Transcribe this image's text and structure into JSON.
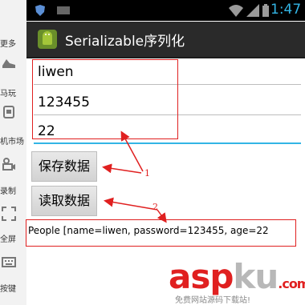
{
  "sidebar": {
    "items": [
      {
        "label": "更多",
        "icon": "more-icon"
      },
      {
        "label": "马玩",
        "icon": "shoe-icon"
      },
      {
        "label": "机市场",
        "icon": "market-icon"
      },
      {
        "label": "录制",
        "icon": "camera-icon"
      },
      {
        "label": "全屏",
        "icon": "fullscreen-icon"
      },
      {
        "label": "按键",
        "icon": "keyboard-icon"
      }
    ]
  },
  "statusbar": {
    "time": "1:47",
    "time_color": "#33b5e5"
  },
  "actionbar": {
    "title": "Serializable序列化",
    "app_icon": "android-icon"
  },
  "fields": [
    {
      "value": "liwen"
    },
    {
      "value": "123455"
    },
    {
      "value": "22"
    }
  ],
  "buttons": {
    "save_label": "保存数据",
    "read_label": "读取数据"
  },
  "output": {
    "text": "People [name=liwen, password=123455, age=22"
  },
  "annotations": {
    "one": "1",
    "two": "2",
    "color": "#e02020"
  },
  "watermark": {
    "main_red": "asp",
    "main_gray": "ku",
    "main_suffix": ".com",
    "sub": "免费网站源码下载站!"
  }
}
